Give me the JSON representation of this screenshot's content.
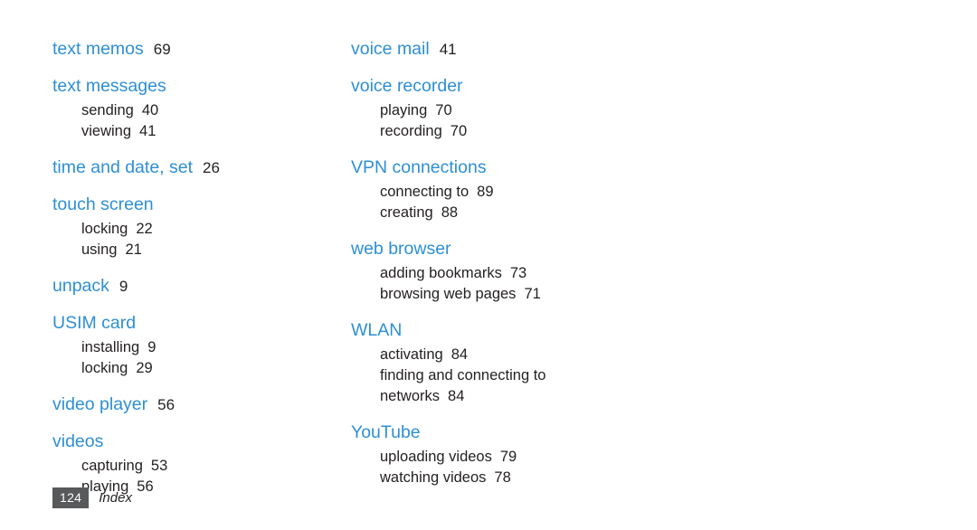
{
  "page": {
    "folio": "124",
    "footer_label": "Index",
    "accent_color": "#2e8fd4",
    "folio_bg_color": "#58595b",
    "text_color": "#231f20"
  },
  "columns": [
    {
      "entries": [
        {
          "term": "text memos",
          "page": "69",
          "subentries": []
        },
        {
          "term": "text messages",
          "page": "",
          "subentries": [
            {
              "label": "sending",
              "page": "40"
            },
            {
              "label": "viewing",
              "page": "41"
            }
          ]
        },
        {
          "term": "time and date, set",
          "page": "26",
          "subentries": []
        },
        {
          "term": "touch screen",
          "page": "",
          "subentries": [
            {
              "label": "locking",
              "page": "22"
            },
            {
              "label": "using",
              "page": "21"
            }
          ]
        },
        {
          "term": "unpack",
          "page": "9",
          "subentries": []
        },
        {
          "term": "USIM card",
          "page": "",
          "subentries": [
            {
              "label": "installing",
              "page": "9"
            },
            {
              "label": "locking",
              "page": "29"
            }
          ]
        },
        {
          "term": "video player",
          "page": "56",
          "subentries": []
        },
        {
          "term": "videos",
          "page": "",
          "subentries": [
            {
              "label": "capturing",
              "page": "53"
            },
            {
              "label": "playing",
              "page": "56"
            }
          ]
        }
      ]
    },
    {
      "entries": [
        {
          "term": "voice mail",
          "page": "41",
          "subentries": []
        },
        {
          "term": "voice recorder",
          "page": "",
          "subentries": [
            {
              "label": "playing",
              "page": "70"
            },
            {
              "label": "recording",
              "page": "70"
            }
          ]
        },
        {
          "term": "VPN connections",
          "page": "",
          "subentries": [
            {
              "label": "connecting to",
              "page": "89"
            },
            {
              "label": "creating",
              "page": "88"
            }
          ]
        },
        {
          "term": "web browser",
          "page": "",
          "subentries": [
            {
              "label": "adding bookmarks",
              "page": "73"
            },
            {
              "label": "browsing web pages",
              "page": "71"
            }
          ]
        },
        {
          "term": "WLAN",
          "page": "",
          "subentries": [
            {
              "label": "activating",
              "page": "84"
            },
            {
              "label": "finding and connecting to",
              "page": ""
            },
            {
              "label": "networks",
              "page": "84"
            }
          ]
        },
        {
          "term": "YouTube",
          "page": "",
          "subentries": [
            {
              "label": "uploading videos",
              "page": "79"
            },
            {
              "label": "watching videos",
              "page": "78"
            }
          ]
        }
      ]
    }
  ]
}
